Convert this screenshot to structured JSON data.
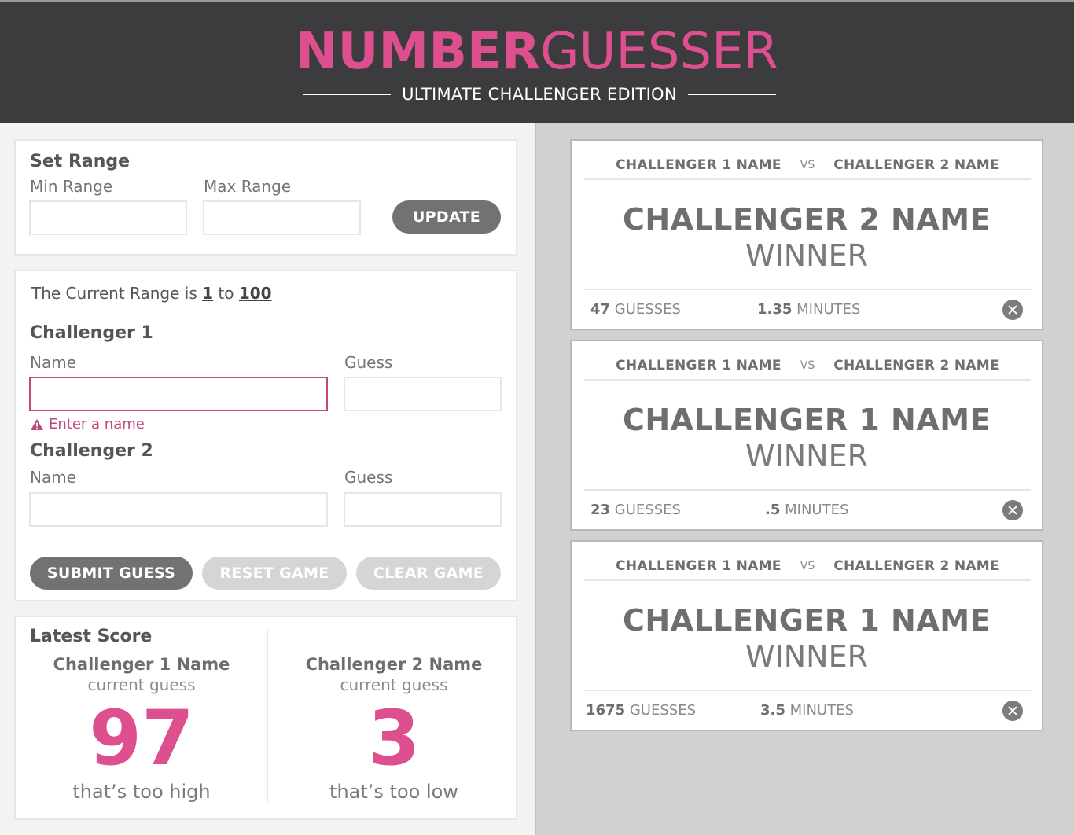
{
  "header": {
    "title_bold": "NUMBER",
    "title_light": "GUESSER",
    "subtitle": "ULTIMATE CHALLENGER EDITION"
  },
  "set_range": {
    "heading": "Set Range",
    "min_label": "Min Range",
    "max_label": "Max Range",
    "min_value": "",
    "max_value": "",
    "update_label": "UPDATE"
  },
  "current_range": {
    "prefix": "The Current Range is",
    "min": "1",
    "to": "to",
    "max": "100"
  },
  "challenger1": {
    "heading": "Challenger 1",
    "name_label": "Name",
    "guess_label": "Guess",
    "name_value": "",
    "guess_value": "",
    "error": "Enter a name"
  },
  "challenger2": {
    "heading": "Challenger 2",
    "name_label": "Name",
    "guess_label": "Guess",
    "name_value": "",
    "guess_value": ""
  },
  "buttons": {
    "submit": "SUBMIT GUESS",
    "reset": "RESET GAME",
    "clear": "CLEAR GAME"
  },
  "latest_score": {
    "heading": "Latest Score",
    "left": {
      "name": "Challenger 1 Name",
      "sub": "current guess",
      "number": "97",
      "message": "that’s too high"
    },
    "right": {
      "name": "Challenger 2 Name",
      "sub": "current guess",
      "number": "3",
      "message": "that’s too low"
    }
  },
  "cards": [
    {
      "c1": "CHALLENGER 1 NAME",
      "vs": "VS",
      "c2": "CHALLENGER 2 NAME",
      "winner": "CHALLENGER 2 NAME",
      "winner_label": "WINNER",
      "guesses": "47",
      "guesses_label": "GUESSES",
      "minutes": "1.35",
      "minutes_label": "MINUTES"
    },
    {
      "c1": "CHALLENGER 1 NAME",
      "vs": "VS",
      "c2": "CHALLENGER 2 NAME",
      "winner": "CHALLENGER 1 NAME",
      "winner_label": "WINNER",
      "guesses": "23",
      "guesses_label": "GUESSES",
      "minutes": ".5",
      "minutes_label": "MINUTES"
    },
    {
      "c1": "CHALLENGER 1 NAME",
      "vs": "VS",
      "c2": "CHALLENGER 2 NAME",
      "winner": "CHALLENGER 1 NAME",
      "winner_label": "WINNER",
      "guesses": "1675",
      "guesses_label": "GUESSES",
      "minutes": "3.5",
      "minutes_label": "MINUTES"
    }
  ],
  "colors": {
    "accent_pink": "#dd4f8f",
    "error_pink": "#c2477f",
    "header_bg": "#3c3c3e",
    "button_dark": "#727274",
    "button_disabled": "#d5d5d7"
  },
  "icons": {
    "warning": "warning-icon",
    "close": "close-icon"
  }
}
